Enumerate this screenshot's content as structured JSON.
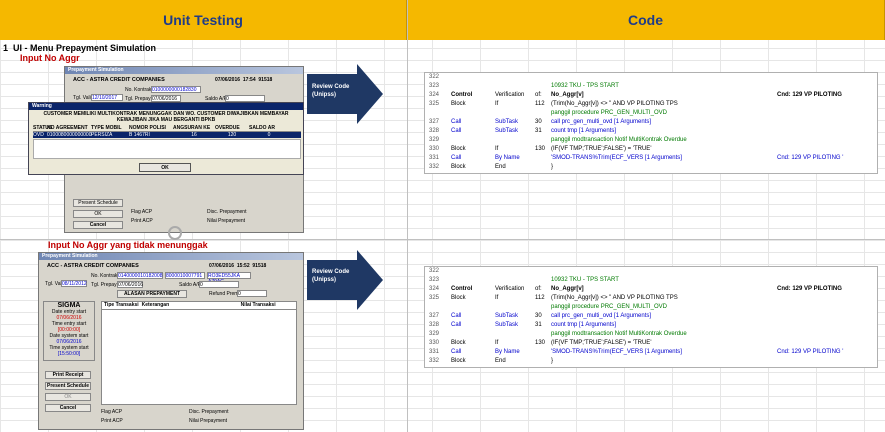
{
  "headers": {
    "left": "Unit Testing",
    "right": "Code"
  },
  "section": {
    "number": "1",
    "title": "UI - Menu Prepayment Simulation"
  },
  "cases": [
    {
      "label": "Input No Aggr",
      "review": "Review Code (Unipss)"
    },
    {
      "label": "Input No Aggr yang tidak menunggak",
      "review": "Review Code (Unipss)"
    }
  ],
  "form1": {
    "window_title": "Prepayment Simulation",
    "company": "ACC - ASTRA CREDIT COMPANIES",
    "date": "07/06/2016",
    "time": "17:54",
    "code": "91518",
    "no_kontrak_label": "No. Kontrak",
    "no_kontrak": "0100000000182830",
    "tgl_valid_label": "Tgl. Valid",
    "tgl_valid": "12/10/2017",
    "tgl_prepay_label": "Tgl. Prepay",
    "tgl_prepay": "07/06/2016",
    "saldo_label": "Saldo A/R",
    "saldo": "0",
    "warning_title": "Warning",
    "warning_text": "CUSTOMER MEMILIKI MULTIKONTRAK MENUNGGAK DAN WO. CUSTOMER DIWAJIBKAN MEMBAYAR KEWAJIBAN JIKA MAU BERGANTI BPKB",
    "cols": [
      "STATUS",
      "NO AGREEMENT",
      "TYPE MOBIL",
      "NOMOR POLISI",
      "ANGSURAN KE",
      "OVERDUE",
      "SALDO AR"
    ],
    "row": [
      "OVD",
      "0100080000000000",
      "PERSIZA",
      "B 1467RI",
      "16",
      "120",
      "0"
    ],
    "ok": "OK",
    "present_schedule": "Present Schedule",
    "ok2": "OK",
    "cancel": "Cancel",
    "flag_acp": "Flag ACP",
    "print_acp": "Print ACP",
    "disc_prepay": "Disc. Prepayment",
    "nilai_prepay": "Nilai Prepayment"
  },
  "form2": {
    "window_title": "Prepayment Simulation",
    "company": "ACC - ASTRA CREDIT COMPANIES",
    "date": "07/06/2016",
    "time": "15:52",
    "code": "91518",
    "no_kontrak_label": "No. Kontrak",
    "no_kontrak": "0140000010182008",
    "extra1": "8000010007791",
    "extra2": "RO3ED55JKA A79AC",
    "tgl_valid_label": "Tgl. Valid",
    "tgl_valid": "08/11/2012",
    "tgl_prepay_label": "Tgl. Prepay",
    "tgl_prepay": "07/06/2016",
    "saldo_label": "Saldo A/R",
    "saldo": "0",
    "alasan": "ALASAN PREPAYMENT",
    "refund_label": "Refund Prem",
    "refund": "0",
    "sigma": "SIGMA",
    "de1": "Date entry start",
    "de1v": "07/06/2016",
    "te1": "Time entry start",
    "te1v": "[00:00:00]",
    "ds": "Date system start",
    "dsv": "07/06/2016",
    "ts": "Time system start",
    "tsv": "[15:50:00]",
    "cols": [
      "Tipe Transaksi",
      "Keterangan",
      "Nilai Transaksi"
    ],
    "print_receipt": "Print Receipt",
    "present_schedule": "Present Schedule",
    "ok": "OK",
    "cancel": "Cancel",
    "flag_acp": "Flag ACP",
    "print_acp": "Print ACP",
    "disc_prepay": "Disc. Prepayment",
    "nilai_prepay": "Nilai Prepayment"
  },
  "code_lines": [
    {
      "n": "322",
      "a": "",
      "b": "",
      "c": "",
      "d": "",
      "x": ""
    },
    {
      "n": "323",
      "a": "",
      "b": "",
      "c": "",
      "d": "10932 TKU - TPS START",
      "x": ""
    },
    {
      "n": "324",
      "a": "Control",
      "b": "Verification",
      "c": "of:",
      "d": "No_Aggr[v]",
      "x": "Cnd:  129   VP PILOTING"
    },
    {
      "n": "325",
      "a": "Block",
      "b": "If",
      "c": "112",
      "d": "(Trim(No_Aggr[v]) <> \" AND VP PILOTING TPS",
      "x": ""
    },
    {
      "n": "",
      "a": "",
      "b": "",
      "c": "",
      "d": "panggil procedure PRC_GEN_MULTI_OVD",
      "x": ""
    },
    {
      "n": "327",
      "a": "Call",
      "b": "SubTask",
      "c": "30",
      "d": "call prc_gen_multi_ovd              [1 Arguments]",
      "x": ""
    },
    {
      "n": "328",
      "a": "Call",
      "b": "SubTask",
      "c": "31",
      "d": "count tmp                               [1 Arguments]",
      "x": ""
    },
    {
      "n": "329",
      "a": "",
      "b": "",
      "c": "",
      "d": "panggil modtransaction Notif MultiKontrak Overdue",
      "x": ""
    },
    {
      "n": "330",
      "a": "Block",
      "b": "If",
      "c": "130",
      "d": "(IF(VF TMP;'TRUE';FALSE') = 'TRUE'",
      "x": ""
    },
    {
      "n": "331",
      "a": "Call",
      "b": "By Name",
      "c": "",
      "d": "'SMOD-TRANS%Trim(ECF_VERS [1 Arguments]",
      "x": "Cnd:  129   VP PILOTING '"
    },
    {
      "n": "332",
      "a": "Block",
      "b": "End",
      "c": "",
      "d": "}",
      "x": ""
    }
  ]
}
